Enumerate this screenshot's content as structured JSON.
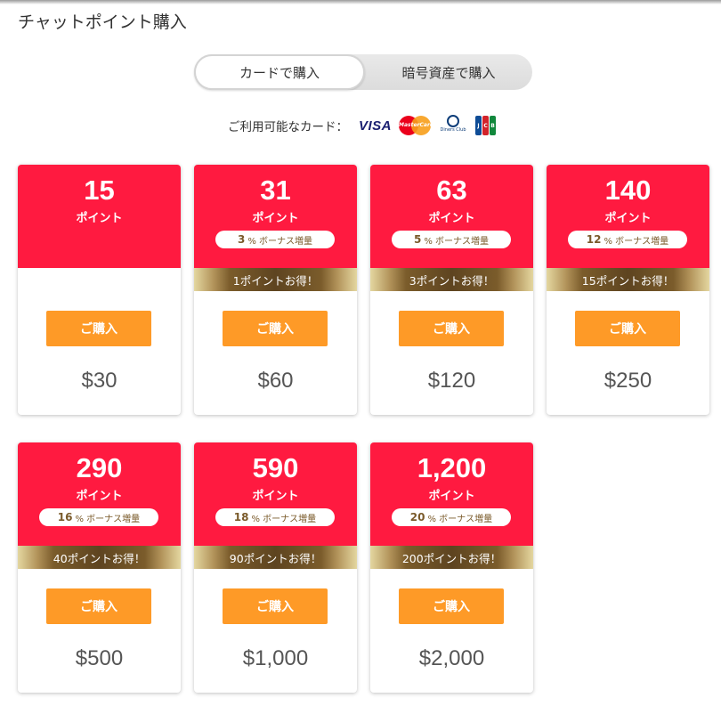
{
  "page": {
    "title": "チャットポイント購入"
  },
  "tabs": [
    {
      "label": "カードで購入",
      "active": true
    },
    {
      "label": "暗号資産で購入",
      "active": false
    }
  ],
  "payment": {
    "label": "ご利用可能なカード：",
    "visa": "VISA",
    "mastercard": "MasterCard",
    "diners": "Diners Club",
    "jcb": [
      "J",
      "C",
      "B"
    ]
  },
  "unit_label": "ポイント",
  "buy_label": "ご購入",
  "bonus_suffix": "% ボーナス増量",
  "colors": {
    "card_top": "#ff1a40",
    "buy_button": "#fe9a27",
    "bonus_text": "#7a5a2a"
  },
  "cards": [
    {
      "points": "15",
      "bonus": "",
      "deal": "",
      "price": "$30"
    },
    {
      "points": "31",
      "bonus": "3",
      "deal": "1ポイントお得！",
      "price": "$60"
    },
    {
      "points": "63",
      "bonus": "5",
      "deal": "3ポイントお得！",
      "price": "$120"
    },
    {
      "points": "140",
      "bonus": "12",
      "deal": "15ポイントお得！",
      "price": "$250"
    },
    {
      "points": "290",
      "bonus": "16",
      "deal": "40ポイントお得！",
      "price": "$500"
    },
    {
      "points": "590",
      "bonus": "18",
      "deal": "90ポイントお得！",
      "price": "$1,000"
    },
    {
      "points": "1,200",
      "bonus": "20",
      "deal": "200ポイントお得！",
      "price": "$2,000"
    }
  ]
}
